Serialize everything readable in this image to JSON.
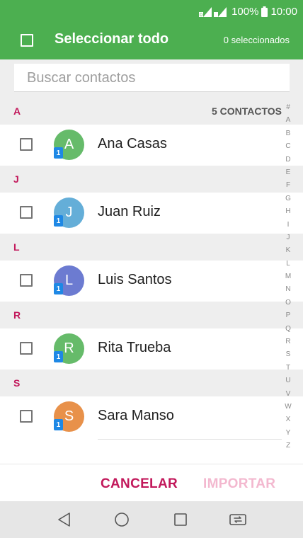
{
  "status_bar": {
    "battery": "100%",
    "time": "10:00"
  },
  "app_bar": {
    "title": "Seleccionar todo",
    "selected_count": "0 seleccionados"
  },
  "search": {
    "placeholder": "Buscar contactos"
  },
  "list": {
    "contacts_count": "5 CONTACTOS",
    "sections": [
      {
        "letter": "A",
        "contacts": [
          {
            "initial": "A",
            "name": "Ana Casas",
            "sim": "1",
            "color": "#66bb6a"
          }
        ]
      },
      {
        "letter": "J",
        "contacts": [
          {
            "initial": "J",
            "name": "Juan Ruiz",
            "sim": "1",
            "color": "#64aed8"
          }
        ]
      },
      {
        "letter": "L",
        "contacts": [
          {
            "initial": "L",
            "name": "Luis Santos",
            "sim": "1",
            "color": "#6c7bd1"
          }
        ]
      },
      {
        "letter": "R",
        "contacts": [
          {
            "initial": "R",
            "name": "Rita Trueba",
            "sim": "1",
            "color": "#66bb6a"
          }
        ]
      },
      {
        "letter": "S",
        "contacts": [
          {
            "initial": "S",
            "name": "Sara Manso",
            "sim": "1",
            "color": "#e8914a"
          }
        ]
      }
    ]
  },
  "index_letters": [
    "#",
    "A",
    "B",
    "C",
    "D",
    "E",
    "F",
    "G",
    "H",
    "I",
    "J",
    "K",
    "L",
    "M",
    "N",
    "O",
    "P",
    "Q",
    "R",
    "S",
    "T",
    "U",
    "V",
    "W",
    "X",
    "Y",
    "Z"
  ],
  "actions": {
    "cancel": "CANCELAR",
    "import": "IMPORTAR"
  },
  "nav": {
    "back_icon": "back-triangle-icon",
    "home_icon": "home-circle-icon",
    "recents_icon": "recents-square-icon",
    "switch_icon": "dual-window-icon"
  },
  "colors": {
    "accent_green": "#4caf50",
    "section_pink": "#c2185b",
    "sim_blue": "#1e88e5"
  }
}
